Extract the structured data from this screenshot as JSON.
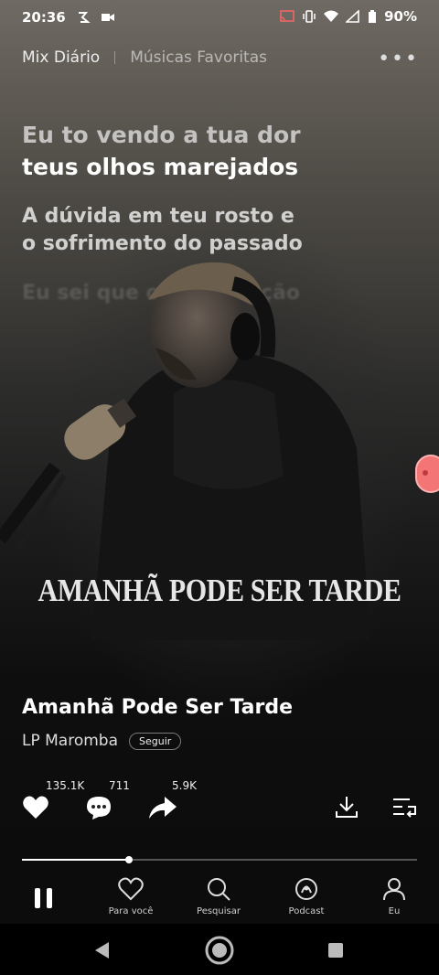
{
  "status_bar": {
    "time": "20:36",
    "battery": "90%"
  },
  "top_tabs": {
    "active": "Mix Diário",
    "inactive": "Músicas Favoritas"
  },
  "lyrics": {
    "line1": "Eu to vendo a tua dor",
    "line2": "teus olhos marejados",
    "line3": "A dúvida em teu rosto e",
    "line4": "o sofrimento do passado",
    "line5": "Eu sei que o teu coração"
  },
  "cover": {
    "title": "AMANHÃ PODE SER TARDE"
  },
  "song": {
    "title": "Amanhã Pode Ser Tarde",
    "artist": "LP Maromba",
    "follow_label": "Seguir"
  },
  "actions": {
    "likes": "135.1K",
    "comments": "711",
    "shares": "5.9K"
  },
  "playback": {
    "progress": 0.27
  },
  "nav": {
    "items": [
      {
        "label": "Para você",
        "icon": "heart-outline-icon"
      },
      {
        "label": "Pesquisar",
        "icon": "search-icon"
      },
      {
        "label": "Podcast",
        "icon": "podcast-icon"
      },
      {
        "label": "Eu",
        "icon": "user-icon"
      }
    ]
  },
  "colors": {
    "accent": "#f37575",
    "background": "#0c0c0c"
  }
}
